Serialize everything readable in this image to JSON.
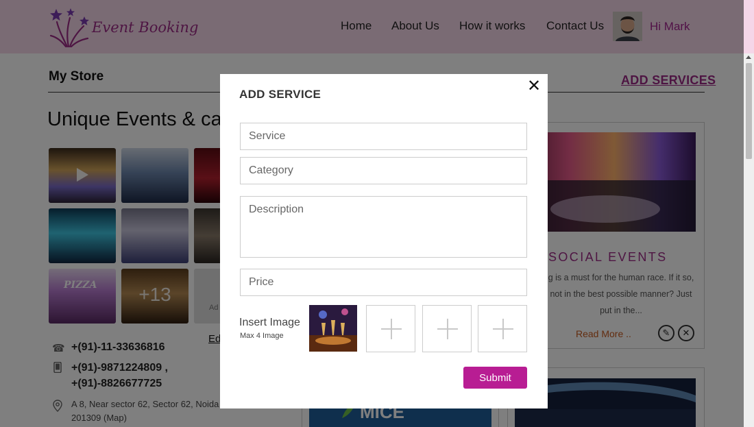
{
  "brand": {
    "name": "Event Booking"
  },
  "nav": {
    "items": [
      "Home",
      "About Us",
      "How it works",
      "Contact Us"
    ],
    "greeting": "Hi Mark"
  },
  "store": {
    "heading": "My Store",
    "add_services": "ADD SERVICES",
    "title": "Unique Events & ca",
    "gallery": {
      "pizza_label": "PIZZA",
      "more_count": "+13",
      "add_label": "Ad"
    },
    "edit_label": "Ed",
    "phone": "+(91)-11-33636816",
    "mobile_1": "+(91)-9871224809 ,",
    "mobile_2": "+(91)-8826677725",
    "address": "A 8, Near sector 62, Sector 62, Noida - 201309 (Map)"
  },
  "cards": {
    "social_title": "SOCIAL EVENTS",
    "social_desc": "g is a must for the human race. If it so, not in the best possible manner? Just put in the...",
    "read_more": "Read More ..",
    "mice_label": "MICE"
  },
  "modal": {
    "title": "ADD SERVICE",
    "close": "✕",
    "service_placeholder": "Service",
    "category_placeholder": "Category",
    "description_placeholder": "Description",
    "price_placeholder": "Price",
    "insert_image": "Insert Image",
    "max_image": "Max 4 Image",
    "submit": "Submit"
  },
  "colors": {
    "brand": "#9c2b86",
    "header_bg": "#f5d6e8",
    "submit": "#b81d93"
  },
  "icons": [
    "logo-stars-icon",
    "phone-icon",
    "mobile-icon",
    "location-icon",
    "pencil-icon",
    "delete-icon",
    "close-icon",
    "play-icon",
    "plus-icon"
  ]
}
